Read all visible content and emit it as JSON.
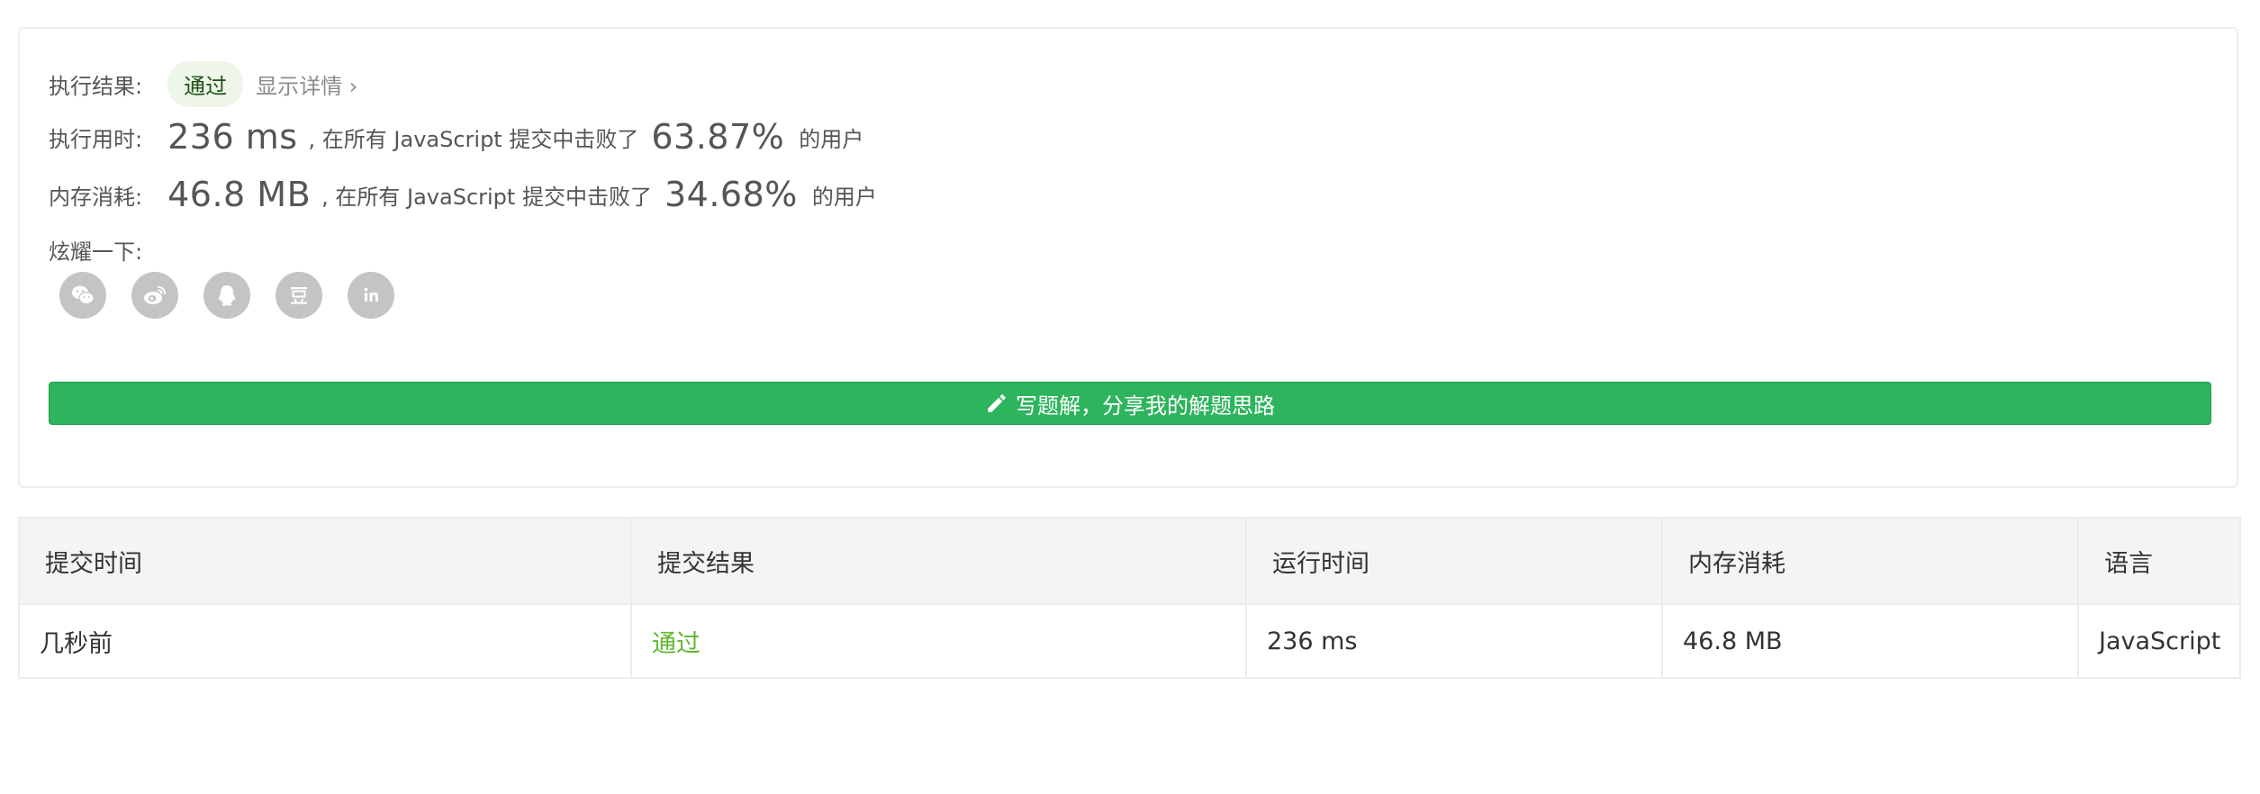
{
  "result": {
    "label": "执行结果:",
    "status": "通过",
    "details_link": "显示详情 ›"
  },
  "runtime": {
    "label": "执行用时:",
    "value": "236 ms",
    "mid_text": ", 在所有 JavaScript 提交中击败了",
    "percent": "63.87%",
    "suffix": "的用户"
  },
  "memory": {
    "label": "内存消耗:",
    "value": "46.8 MB",
    "mid_text": ", 在所有 JavaScript 提交中击败了",
    "percent": "34.68%",
    "suffix": "的用户"
  },
  "share": {
    "label": "炫耀一下:",
    "icons": [
      "wechat-icon",
      "weibo-icon",
      "qq-icon",
      "douban-icon",
      "linkedin-icon"
    ]
  },
  "write_solution": {
    "label": "写题解，分享我的解题思路",
    "icon": "pencil-icon",
    "color": "#2eb45c"
  },
  "table": {
    "headers": [
      "提交时间",
      "提交结果",
      "运行时间",
      "内存消耗",
      "语言"
    ],
    "rows": [
      {
        "time": "几秒前",
        "result": "通过",
        "runtime": "236 ms",
        "memory": "46.8 MB",
        "language": "JavaScript"
      }
    ]
  },
  "colors": {
    "accent_green": "#2eb45c",
    "pass_green": "#5cb82e",
    "badge_bg": "#eef6e9"
  }
}
